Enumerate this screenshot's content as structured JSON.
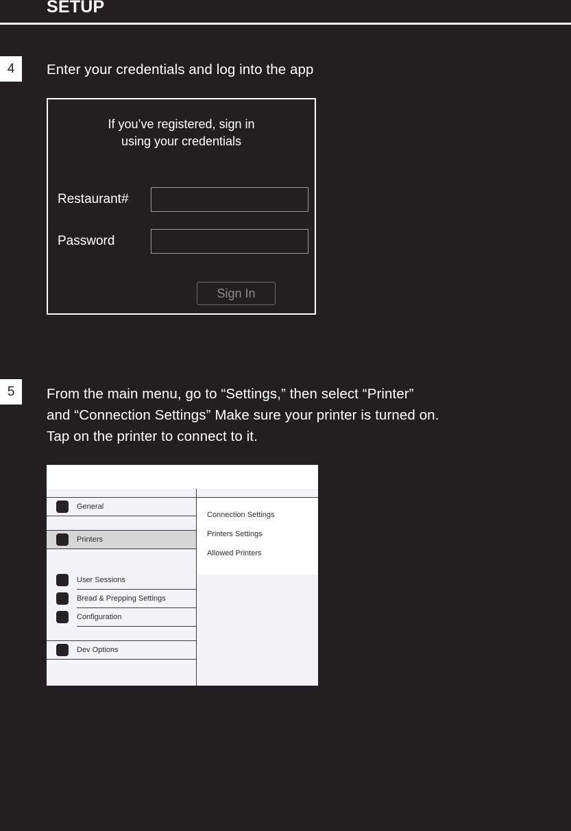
{
  "header": {
    "title": "SETUP"
  },
  "colors": {
    "background": "#231f20",
    "text": "#ffffff",
    "badge_bg": "#ffffff",
    "badge_text": "#231f20",
    "muted": "#8d8a8a",
    "mockup_sidebar_bg": "#f3f3f7",
    "mockup_selected_bg": "#d7d6d6",
    "mockup_panel_bg": "#ffffff",
    "mockup_text": "#2b2b2b",
    "mockup_icon": "#262324"
  },
  "steps": [
    {
      "number": "4",
      "text": "Enter your credentials and log into the app"
    },
    {
      "number": "5",
      "text": "From the main menu, go to “Settings,” then select “Printer”\nand “Connection Settings” Make sure your printer is turned on.\nTap on the printer to connect to it."
    }
  ],
  "login_card": {
    "heading": "If you’ve registered, sign in\nusing your credentials",
    "fields": [
      {
        "label": "Restaurant#",
        "value": "",
        "placeholder": ""
      },
      {
        "label": "Password",
        "value": "",
        "placeholder": ""
      }
    ],
    "submit_label": "Sign In"
  },
  "settings_mockup": {
    "sidebar_items": [
      {
        "label": "General",
        "icon": "settings-icon",
        "selected": false
      },
      {
        "label": "Printers",
        "icon": "printer-icon",
        "selected": true
      },
      {
        "label": "User Sessions",
        "icon": "users-icon",
        "selected": false
      },
      {
        "label": "Bread & Prepping Settings",
        "icon": "bread-icon",
        "selected": false
      },
      {
        "label": "Configuration",
        "icon": "wrench-icon",
        "selected": false
      },
      {
        "label": "Dev Options",
        "icon": "code-icon",
        "selected": false
      }
    ],
    "detail_items": [
      {
        "label": "Connection Settings"
      },
      {
        "label": "Printers Settings"
      },
      {
        "label": "Allowed Printers"
      }
    ]
  }
}
